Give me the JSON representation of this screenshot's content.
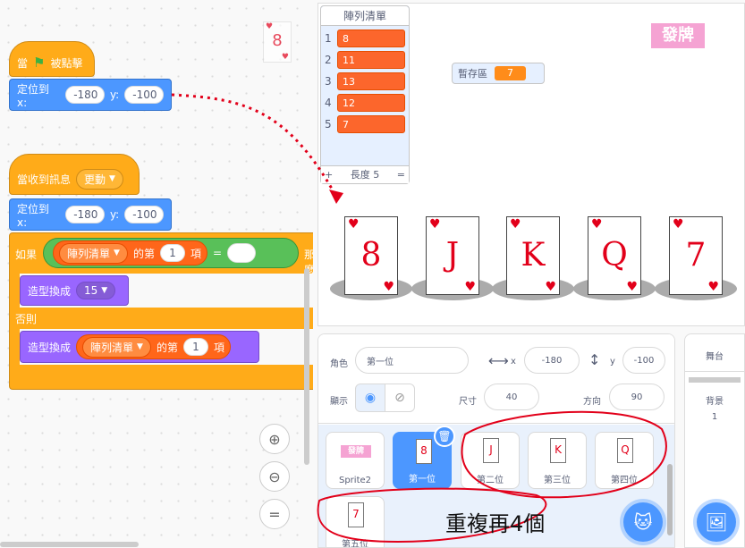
{
  "code": {
    "script1": {
      "when_label": "當",
      "flag_clicked_label": "被點擊",
      "goto_label": "定位到 x:",
      "x_value": "-180",
      "y_label": "y:",
      "y_value": "-100"
    },
    "script2": {
      "receive_label": "當收到訊息",
      "message_value": "更動",
      "goto_label": "定位到 x:",
      "x_value": "-180",
      "y_label": "y:",
      "y_value": "-100",
      "if_label": "如果",
      "list_name": "陣列清單",
      "item_of_label": "的第",
      "index_value": "1",
      "item_label": "項",
      "equals_label": "=",
      "then_label": "那麼",
      "switch_label": "造型換成",
      "costume_value": "15",
      "else_label": "否則",
      "switch2_label": "造型換成",
      "list_name2": "陣列清單",
      "item_of_label2": "的第",
      "index_value2": "1",
      "item_label2": "項"
    },
    "sprite_preview_rank": "8",
    "zoom_reset_label": "="
  },
  "stage": {
    "list_monitor": {
      "title": "陣列清單",
      "items": [
        {
          "index": "1",
          "value": "8"
        },
        {
          "index": "2",
          "value": "11"
        },
        {
          "index": "3",
          "value": "13"
        },
        {
          "index": "4",
          "value": "12"
        },
        {
          "index": "5",
          "value": "7"
        }
      ],
      "add_label": "+",
      "length_label": "長度 5",
      "resize_label": "="
    },
    "variable_monitor": {
      "label": "暫存區",
      "value": "7"
    },
    "deal_label": "發牌",
    "cards": [
      "8",
      "J",
      "K",
      "Q",
      "7"
    ]
  },
  "sprite_info": {
    "sprite_label": "角色",
    "sprite_name": "第一位",
    "x_label": "x",
    "x_value": "-180",
    "y_label": "y",
    "y_value": "-100",
    "show_label": "顯示",
    "size_label": "尺寸",
    "size_value": "40",
    "direction_label": "方向",
    "direction_value": "90"
  },
  "sprites": [
    {
      "name": "Sprite2",
      "thumb": "發牌",
      "selected": false
    },
    {
      "name": "第一位",
      "thumb": "8",
      "selected": true
    },
    {
      "name": "第二位",
      "thumb": "J",
      "selected": false
    },
    {
      "name": "第三位",
      "thumb": "K",
      "selected": false
    },
    {
      "name": "第四位",
      "thumb": "Q",
      "selected": false
    },
    {
      "name": "第五位",
      "thumb": "7",
      "selected": false
    }
  ],
  "stage_pane": {
    "title": "舞台",
    "backdrop_label": "背景",
    "backdrop_count": "1"
  },
  "annotation": "重複再4個",
  "colors": {
    "events": "#ffab19",
    "motion": "#4c97ff",
    "looks": "#9966ff",
    "operators": "#59c059",
    "list": "#ff661a",
    "annotation_red": "#e2001a",
    "card_red": "#e2001a"
  }
}
